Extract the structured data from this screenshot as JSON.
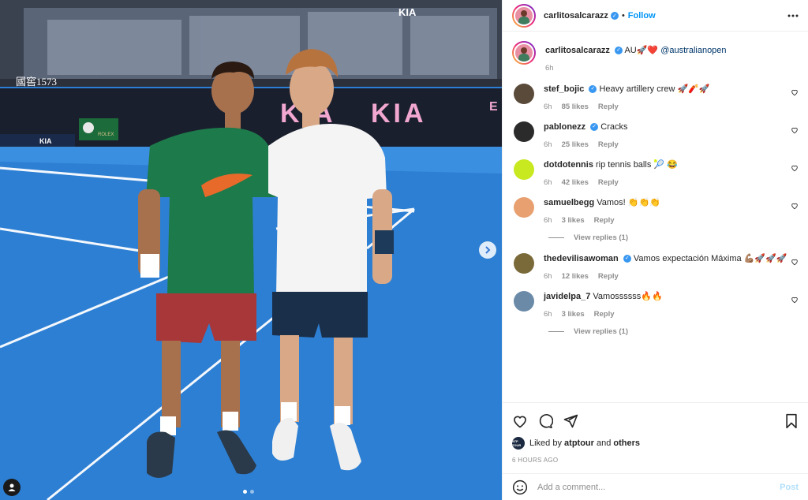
{
  "post": {
    "username": "carlitosalcarazz",
    "follow_label": "Follow",
    "separator": "•",
    "more_label": "•••"
  },
  "photo": {
    "arena_sign_left": "國窖1573",
    "kia_text": "KIA",
    "arena_letter": "E",
    "rolex_text": "ROLEX",
    "carousel_total": 2,
    "carousel_active": 1
  },
  "caption": {
    "username": "carlitosalcarazz",
    "text": "AU🚀❤️",
    "mention": "@australianopen",
    "time": "6h"
  },
  "comments": [
    {
      "username": "stef_bojic",
      "verified": true,
      "text": "Heavy artillery crew 🚀🧨🚀",
      "time": "6h",
      "likes": "85 likes",
      "reply": "Reply",
      "avatar_color": "#5a4a3a"
    },
    {
      "username": "pablonezz",
      "verified": true,
      "text": "Cracks",
      "time": "6h",
      "likes": "25 likes",
      "reply": "Reply",
      "avatar_color": "#2b2b2b"
    },
    {
      "username": "dotdotennis",
      "verified": false,
      "text": "rip tennis balls 🎾 😂",
      "time": "6h",
      "likes": "42 likes",
      "reply": "Reply",
      "avatar_color": "#c8e820"
    },
    {
      "username": "samuelbegg",
      "verified": false,
      "text": "Vamos! 👏👏👏",
      "time": "6h",
      "likes": "3 likes",
      "reply": "Reply",
      "avatar_color": "#e8a070",
      "view_replies": "View replies (1)"
    },
    {
      "username": "thedevilisawoman",
      "verified": true,
      "text": "Vamos expectación Máxima 💪🏽🚀🚀🚀",
      "time": "6h",
      "likes": "12 likes",
      "reply": "Reply",
      "avatar_color": "#7a6a3a"
    },
    {
      "username": "javidelpa_7",
      "verified": false,
      "text": "Vamossssss🔥🔥",
      "time": "6h",
      "likes": "3 likes",
      "reply": "Reply",
      "avatar_color": "#6a8aa8",
      "view_replies": "View replies (1)"
    }
  ],
  "liked_by": {
    "prefix": "Liked by",
    "user": "atptour",
    "suffix": "and",
    "others": "others",
    "avatar_text": "ATP TOUR"
  },
  "timestamp": "6 HOURS AGO",
  "add_comment": {
    "placeholder": "Add a comment...",
    "post_label": "Post"
  },
  "colors": {
    "accent": "#0095f6",
    "verified": "#3897f0",
    "court": "#2d7fd3",
    "kia_pink": "#f1a7d0"
  },
  "icons": [
    "heart-icon",
    "comment-icon",
    "share-icon",
    "bookmark-icon",
    "emoji-icon",
    "chevron-right-icon",
    "user-tag-icon",
    "more-icon",
    "verified-icon"
  ]
}
